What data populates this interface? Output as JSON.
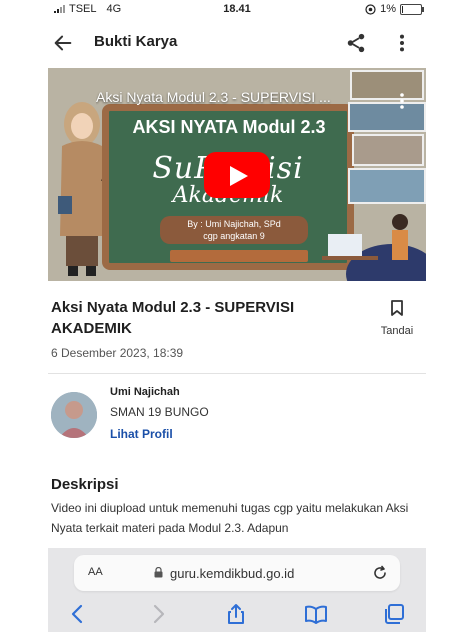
{
  "status": {
    "carrier": "TSEL",
    "network": "4G",
    "time": "18.41",
    "battery": "1%",
    "battery_level": 0.01
  },
  "appbar": {
    "title": "Bukti Karya",
    "back_icon": "arrow-left-icon",
    "share_icon": "share-icon",
    "more_icon": "more-vertical-icon"
  },
  "video": {
    "title": "Aksi Nyata Modul 2.3 - SUPERVISI ...",
    "board_title": "AKSI NYATA Modul 2.3",
    "board_line1": "SuPervisi",
    "board_line2": "Akademik",
    "byline1": "By : Umi Najichah, SPd",
    "byline2": "cgp angkatan 9",
    "play_icon": "youtube-play-icon",
    "colors": {
      "play": "#ff0000",
      "board": "#3f6b4f",
      "frame": "#9c6a45"
    }
  },
  "article": {
    "title": "Aksi Nyata Modul 2.3 - SUPERVISI AKADEMIK",
    "date": "6 Desember 2023, 18:39",
    "bookmark_label": "Tandai",
    "bookmark_icon": "bookmark-icon"
  },
  "author": {
    "name": "Umi Najichah",
    "school": "SMAN 19 BUNGO",
    "profile_link": "Lihat Profil",
    "link_color": "#1a4fa8"
  },
  "description": {
    "heading": "Deskripsi",
    "text": "Video ini diupload untuk memenuhi tugas cgp yaitu melakukan Aksi Nyata terkait materi pada Modul 2.3. Adapun"
  },
  "browser": {
    "aa_label": "AA",
    "url": "guru.kemdikbud.go.id",
    "icons": [
      "chevron-left-icon",
      "chevron-right-icon",
      "share-up-icon",
      "book-icon",
      "tabs-icon"
    ]
  }
}
